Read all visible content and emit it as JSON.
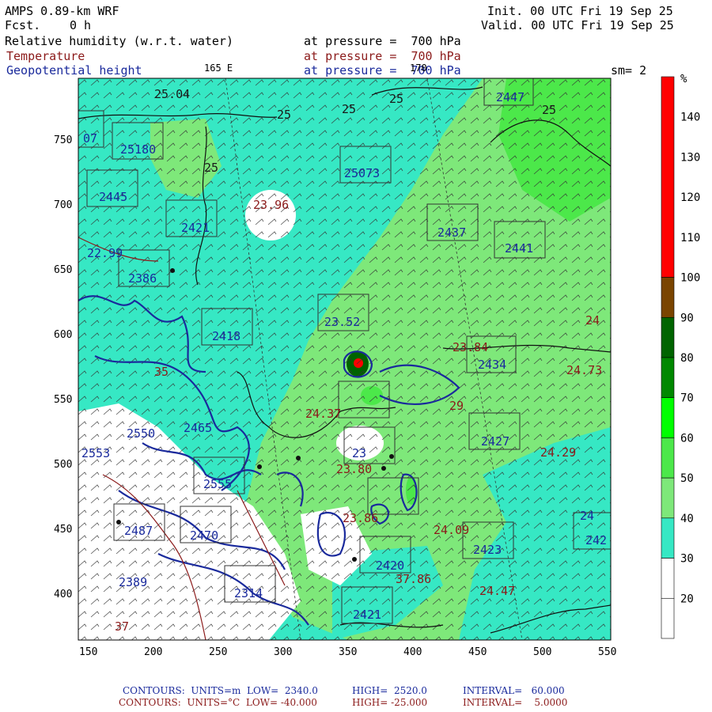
{
  "header": {
    "model": "AMPS 0.89-km WRF",
    "fcst_label": "Fcst.",
    "fcst_value": "0 h",
    "init": "Init. 00 UTC Fri 19 Sep 25",
    "valid": "Valid. 00 UTC Fri 19 Sep 25",
    "field1_name": "Relative humidity (w.r.t. water)",
    "field1_level": "at pressure =  700 hPa",
    "field2_name": "Temperature",
    "field2_level": "at pressure =  700 hPa",
    "field3_name": "Geopotential height",
    "field3_level": "at pressure =  700 hPa",
    "lon_marker_165e": "165 E",
    "lon_marker_170": "170",
    "smooth": "sm= 2"
  },
  "colors": {
    "rh_20_30": "#ffffff",
    "rh_30_40": "#36e8c4",
    "rh_40_50": "#7ee87a",
    "rh_50_60": "#4ce84a",
    "rh_60_70": "#00ff00",
    "rh_70_80": "#008800",
    "rh_80_90": "#006400",
    "rh_90_100": "#7a4400",
    "rh_100_150": "#ff0000",
    "geopotential_contour": "#1a2a9c",
    "temperature_contour": "#8b1a1a"
  },
  "colorbar": {
    "unit": "%",
    "ticks": [
      "140",
      "130",
      "120",
      "110",
      "100",
      "90",
      "80",
      "70",
      "60",
      "50",
      "40",
      "30",
      "20"
    ],
    "segments": [
      {
        "from": 100,
        "to": 150,
        "color": "#ff0000"
      },
      {
        "from": 90,
        "to": 100,
        "color": "#7a4400"
      },
      {
        "from": 80,
        "to": 90,
        "color": "#006400"
      },
      {
        "from": 70,
        "to": 80,
        "color": "#008800"
      },
      {
        "from": 60,
        "to": 70,
        "color": "#00ff00"
      },
      {
        "from": 50,
        "to": 60,
        "color": "#4ce84a"
      },
      {
        "from": 40,
        "to": 50,
        "color": "#7ee87a"
      },
      {
        "from": 30,
        "to": 40,
        "color": "#36e8c4"
      },
      {
        "from": 20,
        "to": 30,
        "color": "#ffffff"
      },
      {
        "from": 10,
        "to": 20,
        "color": "#ffffff"
      }
    ]
  },
  "axes": {
    "x_ticks": [
      "150",
      "200",
      "250",
      "300",
      "350",
      "400",
      "450",
      "500",
      "550"
    ],
    "y_ticks": [
      "750",
      "700",
      "650",
      "600",
      "550",
      "500",
      "450",
      "400"
    ]
  },
  "map_labels": {
    "temp": [
      {
        "text": "25.04",
        "k": "t1"
      },
      {
        "text": "25",
        "k": "t2"
      },
      {
        "text": "25",
        "k": "t3"
      },
      {
        "text": "25",
        "k": "t4"
      },
      {
        "text": "25",
        "k": "t5"
      },
      {
        "text": "25",
        "k": "t6"
      },
      {
        "text": "23.96",
        "k": "t7"
      },
      {
        "text": "23.84",
        "k": "t8"
      },
      {
        "text": "24.73",
        "k": "t9"
      },
      {
        "text": "24",
        "k": "t10"
      },
      {
        "text": "24.37",
        "k": "t11"
      },
      {
        "text": "24.29",
        "k": "t12"
      },
      {
        "text": "24.09",
        "k": "t13"
      },
      {
        "text": "24.47",
        "k": "t14"
      },
      {
        "text": "23.86",
        "k": "t15"
      },
      {
        "text": "23.80",
        "k": "t16"
      },
      {
        "text": "29",
        "k": "t17"
      },
      {
        "text": "37.86",
        "k": "t18"
      },
      {
        "text": "35",
        "k": "t19"
      },
      {
        "text": "37",
        "k": "t20"
      }
    ],
    "geo": [
      {
        "text": "2447",
        "k": "g1"
      },
      {
        "text": "25180",
        "k": "g2"
      },
      {
        "text": "25073",
        "k": "g3"
      },
      {
        "text": "2445",
        "k": "g4"
      },
      {
        "text": "2421",
        "k": "g5"
      },
      {
        "text": "2437",
        "k": "g6"
      },
      {
        "text": "2441",
        "k": "g7"
      },
      {
        "text": "2386",
        "k": "g8"
      },
      {
        "text": "22.99",
        "k": "g9"
      },
      {
        "text": "2418",
        "k": "g10"
      },
      {
        "text": "23.52",
        "k": "g11"
      },
      {
        "text": "2434",
        "k": "g12"
      },
      {
        "text": "2427",
        "k": "g13"
      },
      {
        "text": "2550",
        "k": "g14"
      },
      {
        "text": "2465",
        "k": "g15"
      },
      {
        "text": "2423",
        "k": "g16"
      },
      {
        "text": "2420",
        "k": "g17"
      },
      {
        "text": "2421",
        "k": "g18"
      },
      {
        "text": "2470",
        "k": "g19"
      },
      {
        "text": "2314",
        "k": "g20"
      },
      {
        "text": "2555",
        "k": "g21"
      },
      {
        "text": "2487",
        "k": "g22"
      },
      {
        "text": "2389",
        "k": "g23"
      },
      {
        "text": "23",
        "k": "g24"
      },
      {
        "text": "2553",
        "k": "g25"
      },
      {
        "text": "24",
        "k": "g26"
      },
      {
        "text": "242",
        "k": "g27"
      },
      {
        "text": "07",
        "k": "g28"
      }
    ]
  },
  "footer": {
    "line1_label": "CONTOURS:  UNITS=m  LOW=  2340.0",
    "line1_high": "HIGH=  2520.0",
    "line1_int": "INTERVAL=   60.000",
    "line2_label": "CONTOURS:  UNITS=°C  LOW= -40.000",
    "line2_high": "HIGH= -25.000",
    "line2_int": "INTERVAL=    5.0000"
  }
}
